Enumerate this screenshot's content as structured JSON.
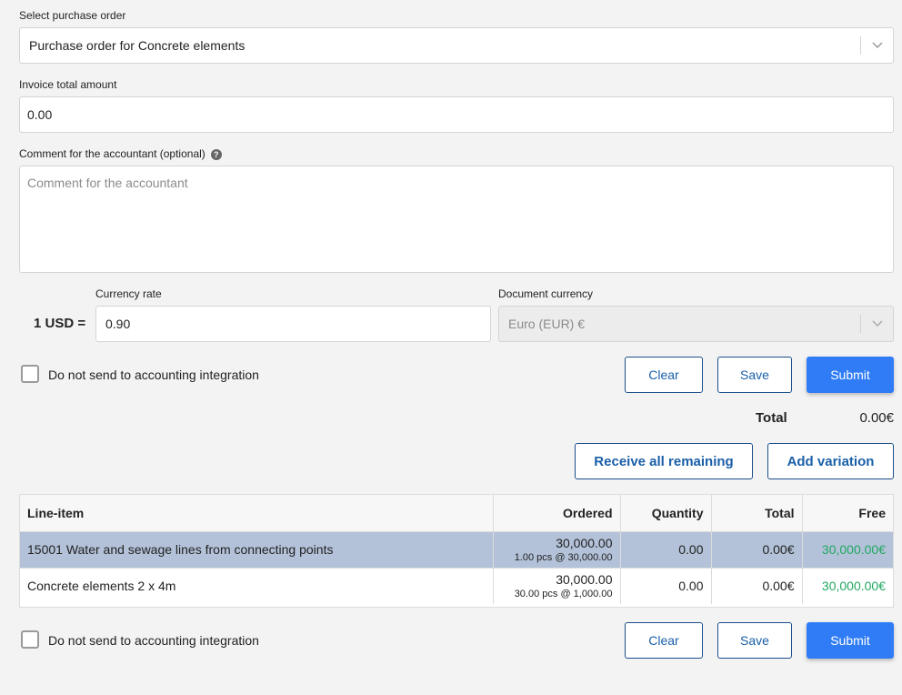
{
  "purchase_order": {
    "label": "Select purchase order",
    "selected": "Purchase order for Concrete elements"
  },
  "invoice_total": {
    "label": "Invoice total amount",
    "value": "0.00"
  },
  "comment": {
    "label": "Comment for the accountant (optional)",
    "help": "?",
    "placeholder": "Comment for the accountant"
  },
  "currency": {
    "prefix": "1 USD =",
    "rate_label": "Currency rate",
    "rate_value": "0.90",
    "doc_label": "Document currency",
    "doc_value": "Euro (EUR) €"
  },
  "actions": {
    "no_send_label": "Do not send to accounting integration",
    "clear": "Clear",
    "save": "Save",
    "submit": "Submit"
  },
  "totals": {
    "label": "Total",
    "value": "0.00€"
  },
  "line_actions": {
    "receive_all": "Receive all remaining",
    "add_variation": "Add variation"
  },
  "table": {
    "headers": [
      "Line-item",
      "Ordered",
      "Quantity",
      "Total",
      "Free"
    ],
    "rows": [
      {
        "item": "15001 Water and sewage lines from connecting points",
        "ordered": "30,000.00",
        "ordered_detail": "1.00 pcs @ 30,000.00",
        "quantity": "0.00",
        "total": "0.00€",
        "free": "30,000.00€",
        "selected": true
      },
      {
        "item": "Concrete elements 2 x 4m",
        "ordered": "30,000.00",
        "ordered_detail": "30.00 pcs @ 1,000.00",
        "quantity": "0.00",
        "total": "0.00€",
        "free": "30,000.00€",
        "selected": false
      }
    ]
  },
  "colors": {
    "primary": "#2f7cf6",
    "outline": "#1a5fa8",
    "free": "#21a861",
    "selected_row": "#b3c2d9"
  }
}
